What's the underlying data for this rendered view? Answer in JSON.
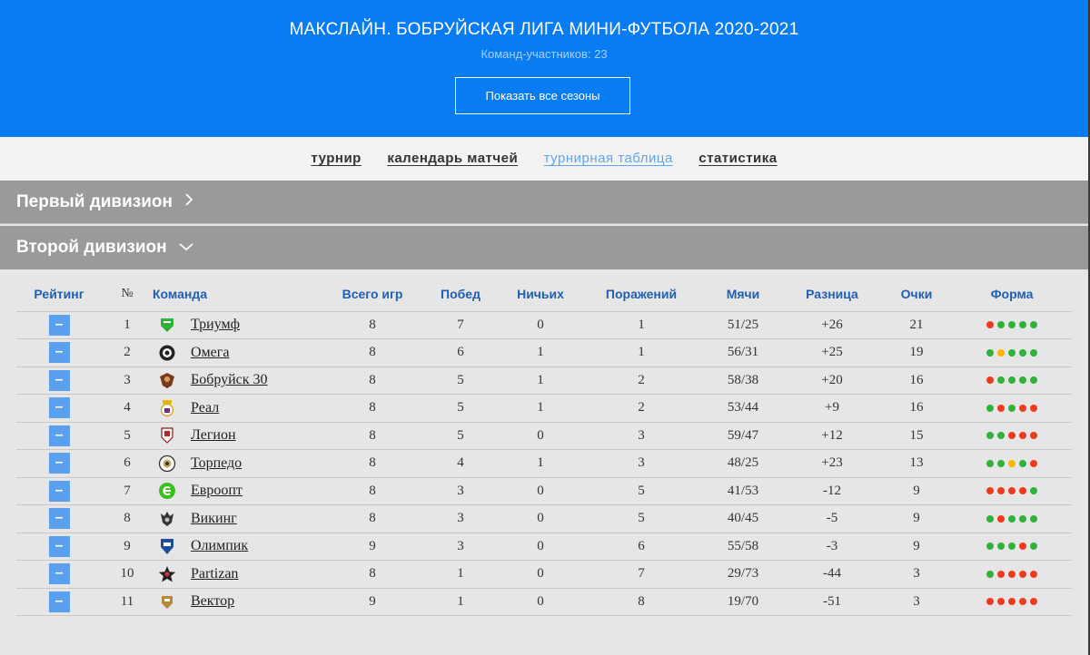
{
  "header": {
    "title": "МАКСЛАЙН. БОБРУЙСКАЯ ЛИГА МИНИ-ФУТБОЛА 2020-2021",
    "subtitle": "Команд-участников: 23",
    "seasons_button": "Показать все сезоны"
  },
  "nav": {
    "tabs": [
      {
        "label": "турнир",
        "active": false
      },
      {
        "label": "календарь матчей",
        "active": false
      },
      {
        "label": "турнирная таблица",
        "active": true
      },
      {
        "label": "статистика",
        "active": false
      }
    ]
  },
  "divisions": {
    "first": {
      "label": "Первый дивизион",
      "arrow": "›"
    },
    "second": {
      "label": "Второй дивизион",
      "arrow": "⌄"
    }
  },
  "colors": {
    "win": "#2fb13a",
    "loss": "#f03a1e",
    "draw": "#ffb300",
    "accent": "#0a7cf2"
  },
  "table": {
    "headers": {
      "rating": "Рейтинг",
      "num": "№",
      "team": "Команда",
      "games": "Всего игр",
      "wins": "Побед",
      "draws": "Ничьих",
      "losses": "Поражений",
      "goals": "Мячи",
      "diff": "Разница",
      "points": "Очки",
      "form": "Форма"
    },
    "rank_symbol": "–",
    "rows": [
      {
        "num": "1",
        "team": "Триумф",
        "games": "8",
        "wins": "7",
        "draws": "0",
        "losses": "1",
        "goals": "51/25",
        "diff": "+26",
        "points": "21",
        "form": [
          "L",
          "W",
          "W",
          "W",
          "W"
        ],
        "logo": "triumph-logo-icon"
      },
      {
        "num": "2",
        "team": "Омега",
        "games": "8",
        "wins": "6",
        "draws": "1",
        "losses": "1",
        "goals": "56/31",
        "diff": "+25",
        "points": "19",
        "form": [
          "W",
          "D",
          "W",
          "W",
          "W"
        ],
        "logo": "omega-logo-icon"
      },
      {
        "num": "3",
        "team": "Бобруйск 30",
        "games": "8",
        "wins": "5",
        "draws": "1",
        "losses": "2",
        "goals": "58/38",
        "diff": "+20",
        "points": "16",
        "form": [
          "L",
          "W",
          "W",
          "W",
          "W"
        ],
        "logo": "bobruisk-logo-icon"
      },
      {
        "num": "4",
        "team": "Реал",
        "games": "8",
        "wins": "5",
        "draws": "1",
        "losses": "2",
        "goals": "53/44",
        "diff": "+9",
        "points": "16",
        "form": [
          "W",
          "L",
          "W",
          "L",
          "L"
        ],
        "logo": "real-logo-icon"
      },
      {
        "num": "5",
        "team": "Легион",
        "games": "8",
        "wins": "5",
        "draws": "0",
        "losses": "3",
        "goals": "59/47",
        "diff": "+12",
        "points": "15",
        "form": [
          "W",
          "W",
          "L",
          "L",
          "L"
        ],
        "logo": "legion-logo-icon"
      },
      {
        "num": "6",
        "team": "Торпедо",
        "games": "8",
        "wins": "4",
        "draws": "1",
        "losses": "3",
        "goals": "48/25",
        "diff": "+23",
        "points": "13",
        "form": [
          "W",
          "W",
          "D",
          "W",
          "L"
        ],
        "logo": "torpedo-logo-icon"
      },
      {
        "num": "7",
        "team": "Евроопт",
        "games": "8",
        "wins": "3",
        "draws": "0",
        "losses": "5",
        "goals": "41/53",
        "diff": "-12",
        "points": "9",
        "form": [
          "L",
          "L",
          "L",
          "L",
          "W"
        ],
        "logo": "evroopt-logo-icon"
      },
      {
        "num": "8",
        "team": "Викинг",
        "games": "8",
        "wins": "3",
        "draws": "0",
        "losses": "5",
        "goals": "40/45",
        "diff": "-5",
        "points": "9",
        "form": [
          "W",
          "L",
          "W",
          "W",
          "W"
        ],
        "logo": "viking-logo-icon"
      },
      {
        "num": "9",
        "team": "Олимпик",
        "games": "9",
        "wins": "3",
        "draws": "0",
        "losses": "6",
        "goals": "55/58",
        "diff": "-3",
        "points": "9",
        "form": [
          "W",
          "W",
          "W",
          "L",
          "W"
        ],
        "logo": "olimpik-logo-icon"
      },
      {
        "num": "10",
        "team": "Partizan",
        "games": "8",
        "wins": "1",
        "draws": "0",
        "losses": "7",
        "goals": "29/73",
        "diff": "-44",
        "points": "3",
        "form": [
          "W",
          "L",
          "L",
          "L",
          "L"
        ],
        "logo": "partizan-logo-icon"
      },
      {
        "num": "11",
        "team": "Вектор",
        "games": "9",
        "wins": "1",
        "draws": "0",
        "losses": "8",
        "goals": "19/70",
        "diff": "-51",
        "points": "3",
        "form": [
          "L",
          "L",
          "L",
          "L",
          "L"
        ],
        "logo": "vektor-logo-icon"
      }
    ]
  }
}
